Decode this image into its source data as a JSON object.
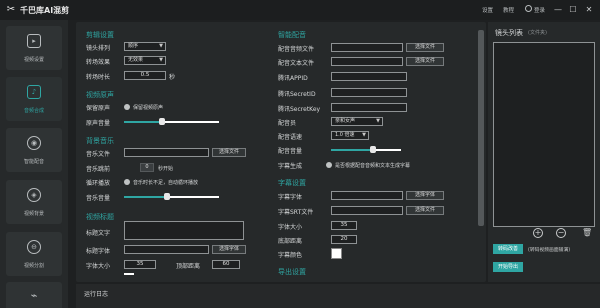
{
  "window": {
    "title": "千巴库AI混剪",
    "links": [
      "设置",
      "教程"
    ],
    "user": "登录",
    "controls": [
      "—",
      "☐",
      "✕"
    ]
  },
  "sidebar": {
    "items": [
      {
        "label": "视频设置",
        "icon": "video-icon",
        "glyph": "▸"
      },
      {
        "label": "音频合成",
        "icon": "audio-icon",
        "glyph": "♪"
      },
      {
        "label": "智能配音",
        "icon": "voice-icon",
        "glyph": "◉"
      },
      {
        "label": "视频背景",
        "icon": "background-icon",
        "glyph": "◈"
      },
      {
        "label": "视频分割",
        "icon": "split-icon",
        "glyph": "⊖"
      },
      {
        "label": "",
        "icon": "satellite-icon",
        "glyph": "⌁"
      }
    ],
    "active_index": 1
  },
  "left": {
    "video_section": "剪辑设置",
    "shot_order": {
      "label": "镜头排列",
      "value": "顺序"
    },
    "transition": {
      "label": "转场效果",
      "value": "无效果"
    },
    "transition_duration": {
      "label": "转场时长",
      "value": "0.5",
      "unit": "秒"
    },
    "original_section": "视频原声",
    "keep_original": {
      "label": "保留原声",
      "option": "保留视频原声"
    },
    "original_volume": {
      "label": "原声音量",
      "level": 0.4
    },
    "bgm_section": "背景音乐",
    "music_file": {
      "label": "音乐文件",
      "button": "选择文件"
    },
    "music_skip": {
      "label": "音乐跳前",
      "value": "0",
      "unit": "秒开始"
    },
    "loop_play": {
      "label": "循环播放",
      "option": "音乐时长不足，自动循环播放"
    },
    "music_volume": {
      "label": "音乐音量",
      "level": 0.45
    },
    "title_section": "视频标题",
    "title_text": {
      "label": "标题文字"
    },
    "title_font": {
      "label": "标题字体",
      "button": "选择字体"
    },
    "font_size": {
      "label": "字体大小",
      "value": "35"
    },
    "top_margin": {
      "label": "顶部距离",
      "value": "60"
    }
  },
  "center": {
    "voice_section": "智能配音",
    "voice_file": {
      "label": "配音音频文件",
      "button": "选择文件"
    },
    "voice_text": {
      "label": "配音文本文件",
      "button": "选择文件"
    },
    "appid": {
      "label": "腾讯APPID"
    },
    "secret_id": {
      "label": "腾讯SecretID"
    },
    "secret_key": {
      "label": "腾讯SecretKey"
    },
    "speaker": {
      "label": "配音员",
      "value": "亲和女声"
    },
    "speed": {
      "label": "配音语速",
      "value": "1.0 倍速"
    },
    "volume": {
      "label": "配音音量",
      "level": 0.6
    },
    "subtitle_gen": {
      "label": "字幕生成",
      "option": "是否根据配音音频和文本生成字幕"
    },
    "subtitle_section": "字幕设置",
    "sub_font": {
      "label": "字幕字体",
      "button": "选择字体"
    },
    "srt_file": {
      "label": "字幕SRT文件",
      "button": "选择文件"
    },
    "sub_font_size": {
      "label": "字体大小",
      "value": "35"
    },
    "bottom_margin": {
      "label": "底部距离",
      "value": "20"
    },
    "sub_color": {
      "label": "字幕颜色",
      "color": "#ffffff"
    },
    "export_section": "导出设置"
  },
  "right": {
    "title": "镜头列表",
    "hint": "(文件夹)",
    "add": "+",
    "remove": "−",
    "delete": "🗑",
    "convert_button": "转码改善",
    "convert_hint": "(转码视频画面铺满)",
    "export_button": "开始导出"
  },
  "log": {
    "title": "运行日志"
  },
  "accent": "#2fa6a3"
}
